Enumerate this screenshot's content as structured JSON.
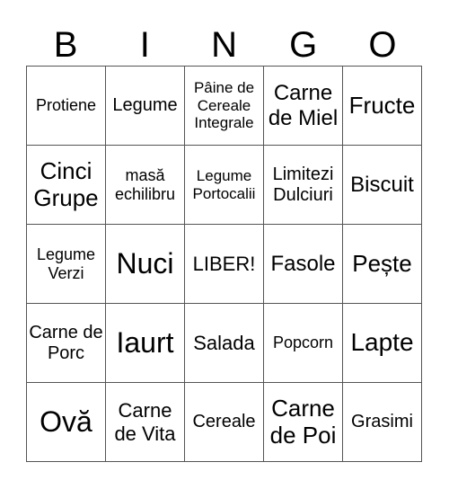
{
  "header": {
    "letters": [
      "B",
      "I",
      "N",
      "G",
      "O"
    ]
  },
  "grid": {
    "rows": [
      [
        "Protiene",
        "Legume",
        "Pâine de Cereale Integrale",
        "Carne de Miel",
        "Fructe"
      ],
      [
        "Cinci Grupe",
        "masă echilibru",
        "Legume Portocalii",
        "Limitezi Dulciuri",
        "Biscuit"
      ],
      [
        "Legume Verzi",
        "Nuci",
        "LIBER!",
        "Fasole",
        "Pește"
      ],
      [
        "Carne de Porc",
        "Iaurt",
        "Salada",
        "Popcorn",
        "Lapte"
      ],
      [
        "Ovă",
        "Carne de Vita",
        "Cereale",
        "Carne de Poi",
        "Grasimi"
      ]
    ]
  }
}
